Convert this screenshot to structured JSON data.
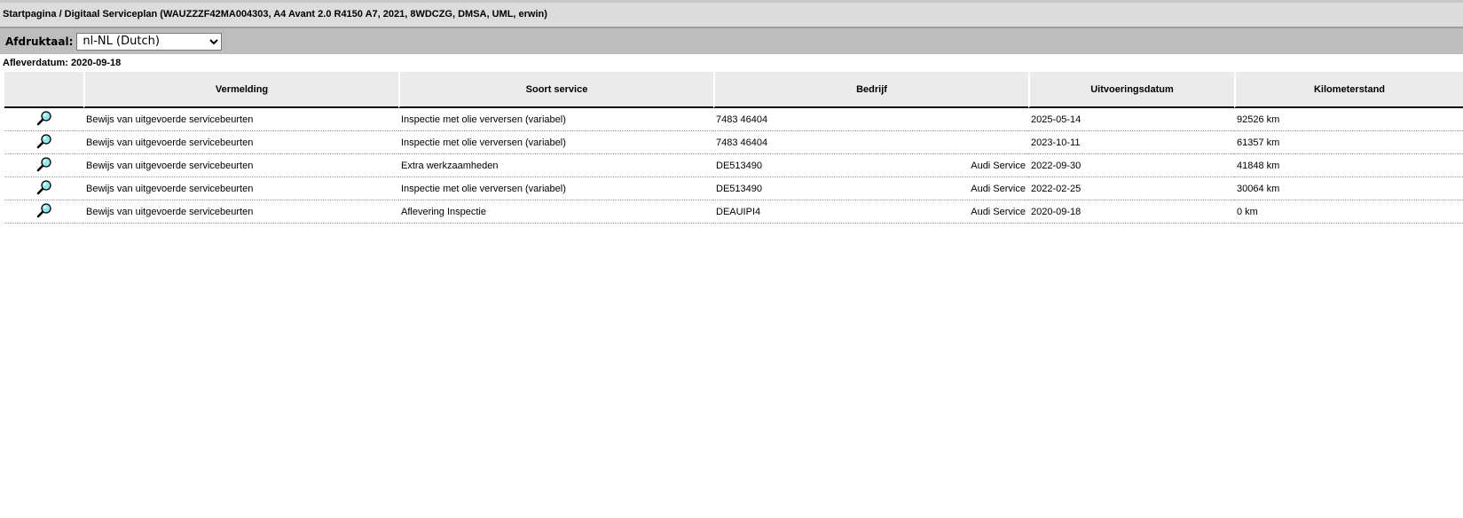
{
  "breadcrumb": "Startpagina / Digitaal Serviceplan (WAUZZZF42MA004303, A4 Avant 2.0 R4150 A7, 2021, 8WDCZG, DMSA, UML, erwin)",
  "language": {
    "label": "Afdruktaal:",
    "selected": "nl-NL (Dutch)"
  },
  "delivery_date": "Afleverdatum: 2020-09-18",
  "table": {
    "headers": [
      "",
      "Vermelding",
      "Soort service",
      "Bedrijf",
      "Uitvoeringsdatum",
      "Kilometerstand"
    ],
    "rows": [
      {
        "entry": "Bewijs van uitgevoerde servicebeurten",
        "service": "Inspectie met olie verversen (variabel)",
        "company_id": "7483 46404",
        "company_name": "",
        "date": "2025-05-14",
        "km": "92526 km"
      },
      {
        "entry": "Bewijs van uitgevoerde servicebeurten",
        "service": "Inspectie met olie verversen (variabel)",
        "company_id": "7483 46404",
        "company_name": "",
        "date": "2023-10-11",
        "km": "61357 km"
      },
      {
        "entry": "Bewijs van uitgevoerde servicebeurten",
        "service": "Extra werkzaamheden",
        "company_id": "DE513490",
        "company_name": "Audi Service",
        "date": "2022-09-30",
        "km": "41848 km"
      },
      {
        "entry": "Bewijs van uitgevoerde servicebeurten",
        "service": "Inspectie met olie verversen (variabel)",
        "company_id": "DE513490",
        "company_name": "Audi Service",
        "date": "2022-02-25",
        "km": "30064 km"
      },
      {
        "entry": "Bewijs van uitgevoerde servicebeurten",
        "service": "Aflevering Inspectie",
        "company_id": "DEAUIPI4",
        "company_name": "Audi Service",
        "date": "2020-09-18",
        "km": "0 km"
      }
    ]
  },
  "icons": {
    "row_action": "magnifier-icon"
  }
}
